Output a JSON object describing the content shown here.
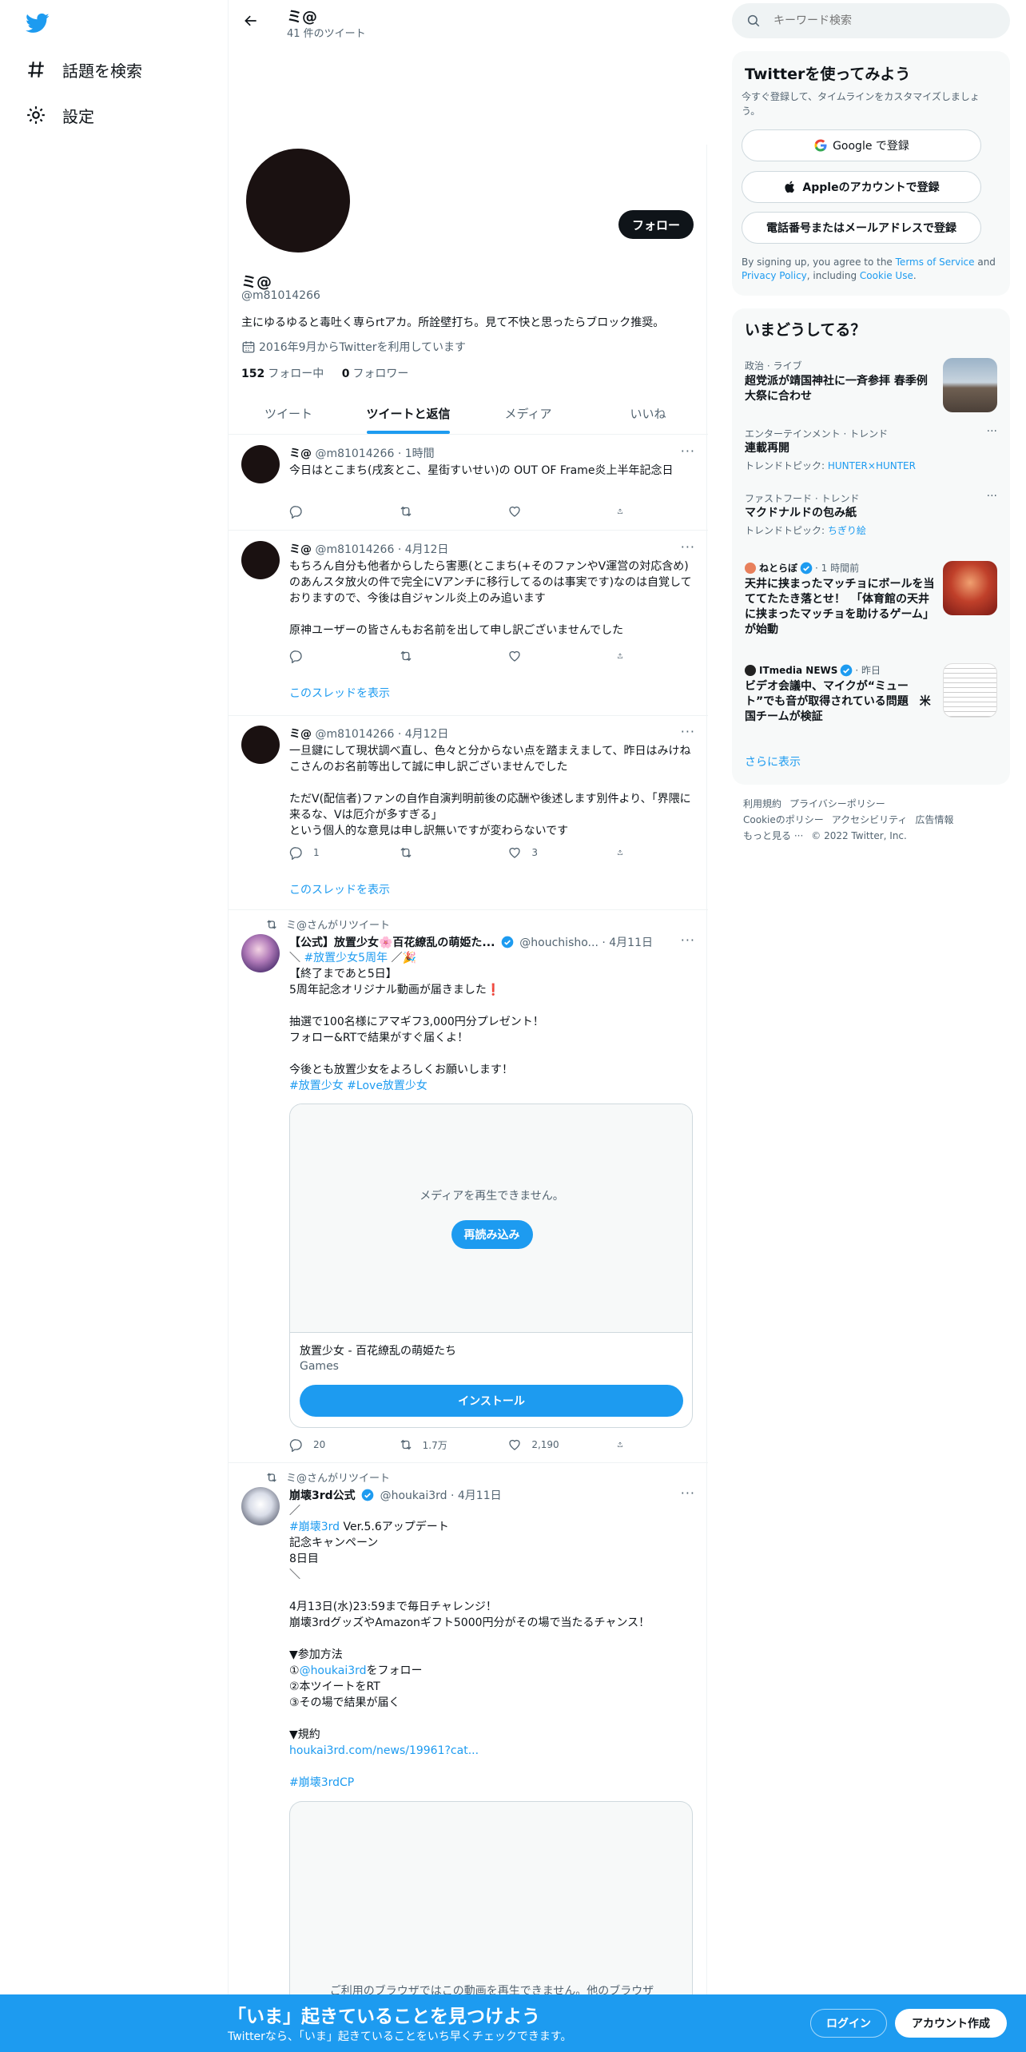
{
  "nav": {
    "explore_label": "話題を検索",
    "settings_label": "設定"
  },
  "header": {
    "name": "ミ@",
    "tweet_count": "41 件のツイート"
  },
  "profile": {
    "name": "ミ@",
    "handle": "@m81014266",
    "bio": "主にゆるゆると毒吐く専らrtアカ。所詮壁打ち。見て不快と思ったらブロック推奨。",
    "joined": "2016年9月からTwitterを利用しています",
    "following_count": "152",
    "following_label": "フォロー中",
    "followers_count": "0",
    "followers_label": "フォロワー",
    "follow_button": "フォロー"
  },
  "tabs": [
    "ツイート",
    "ツイートと返信",
    "メディア",
    "いいね"
  ],
  "tweets": [
    {
      "name": "ミ@",
      "handle": "@m81014266",
      "time": "· 1時間",
      "text": "今日はとこまち(戌亥とこ、星街すいせい)の OUT OF Frame炎上半年記念日"
    },
    {
      "name": "ミ@",
      "handle": "@m81014266",
      "time": "· 4月12日",
      "text": "もちろん自分も他者からしたら害悪(とこまち(+そのファンやV運営の対応含め)のあんスタ放火の件で完全にVアンチに移行してるのは事実です)なのは自覚しておりますので、今後は自ジャンル炎上のみ追います\n\n原神ユーザーの皆さんもお名前を出して申し訳ございませんでした",
      "thread_label": "このスレッドを表示"
    },
    {
      "name": "ミ@",
      "handle": "@m81014266",
      "time": "· 4月12日",
      "text": "一旦鍵にして現状調べ直し、色々と分からない点を踏まえまして、昨日はみけねこさんのお名前等出して誠に申し訳ございませんでした\n\nただV(配信者)ファンの自作自演判明前後の応酬や後述します別件より、「界隈に来るな、Vは厄介が多すぎる」\nという個人的な意見は申し訳無いですが変わらないです",
      "replies": "1",
      "likes": "3",
      "thread_label": "このスレッドを表示"
    },
    {
      "retweet_label": "ミ@さんがリツイート",
      "name": "【公式】放置少女🌸百花繚乱の萌姫た...",
      "handle": "@houchisho...",
      "time": "· 4月11日",
      "text_line1_prefix": "＼ ",
      "text_line1_tag": "#放置少女5周年",
      "text_line1_suffix": " ／🎉",
      "text_body": "【終了まであと5日】\n5周年記念オリジナル動画が届きました❗\n\n抽選で100名様にアマギフ3,000円分プレゼント！\nフォロー&RTで結果がすぐ届くよ！\n\n今後とも放置少女をよろしくお願いします！",
      "hashtags": "#放置少女 #Love放置少女",
      "media_error": "メディアを再生できません。",
      "reload_label": "再読み込み",
      "card_title": "放置少女 - 百花繚乱の萌姫たち",
      "card_category": "Games",
      "install_label": "インストール",
      "replies": "20",
      "retweets": "1.7万",
      "likes": "2,190"
    },
    {
      "retweet_label": "ミ@さんがリツイート",
      "name": "崩壊3rd公式",
      "handle": "@houkai3rd",
      "time": "· 4月11日",
      "line_slash_open": "／",
      "tag_houkai": "#崩壊3rd",
      "line_update": " Ver.5.6アップデート",
      "text_mid": "記念キャンペーン\n8日目\n＼\n\n4月13日(水)23:59まで毎日チャレンジ！\n崩壊3rdグッズやAmazonギフト5000円分がその場で当たるチャンス！\n\n▼参加方法",
      "step1_prefix": "①",
      "step1_mention": "@houkai3rd",
      "step1_suffix": "をフォロー",
      "text_steps": "②本ツイートをRT\n③その場で結果が届く\n\n▼規約",
      "link": "houkai3rd.com/news/19961?cat...",
      "hashtag_cp": "#崩壊3rdCP",
      "media_error": "ご利用のブラウザではこの動画を再生できません。他のブラウザ"
    }
  ],
  "search": {
    "placeholder": "キーワード検索"
  },
  "signup": {
    "title": "Twitterを使ってみよう",
    "desc": "今すぐ登録して、タイムラインをカスタマイズしましょう。",
    "google_label": "Google で登録",
    "apple_label": "Appleのアカウントで登録",
    "phone_label": "電話番号またはメールアドレスで登録",
    "terms_pre": "By signing up, you agree to the ",
    "terms_link": "Terms of Service",
    "terms_and": " and ",
    "privacy_link": "Privacy Policy",
    "terms_including": ", including ",
    "cookie_link": "Cookie Use",
    "terms_end": "."
  },
  "trends": {
    "title": "いまどうしてる？",
    "items": [
      {
        "category": "政治 · ライブ",
        "title": "超党派が靖国神社に一斉参拝 春季例大祭に合わせ"
      },
      {
        "category": "エンターテインメント · トレンド",
        "title": "連載再開",
        "sub_prefix": "トレンドトピック: ",
        "sub_link": "HUNTER×HUNTER"
      },
      {
        "category": "ファストフード · トレンド",
        "title": "マクドナルドの包み紙",
        "sub_prefix": "トレンドトピック: ",
        "sub_link": "ちぎり絵"
      },
      {
        "source": "ねとらぼ",
        "time": "· 1 時間前",
        "title": "天井に挟まったマッチョにボールを当ててたたき落とせ！　「体育館の天井に挟まったマッチョを助けるゲーム」が始動"
      },
      {
        "source": "ITmedia NEWS",
        "time": "· 昨日",
        "title": "ビデオ会議中、マイクが“ミュート”でも音が取得されている問題　米国チームが検証"
      }
    ],
    "more_label": "さらに表示"
  },
  "footer": {
    "links": [
      "利用規約",
      "プライバシーポリシー",
      "Cookieのポリシー",
      "アクセシビリティ",
      "広告情報",
      "もっと見る ···"
    ],
    "copyright": "© 2022 Twitter, Inc."
  },
  "bottom_bar": {
    "title": "「いま」起きていることを見つけよう",
    "subtitle": "Twitterなら、「いま」起きていることをいち早くチェックできます。",
    "login_label": "ログイン",
    "signup_label": "アカウント作成"
  }
}
